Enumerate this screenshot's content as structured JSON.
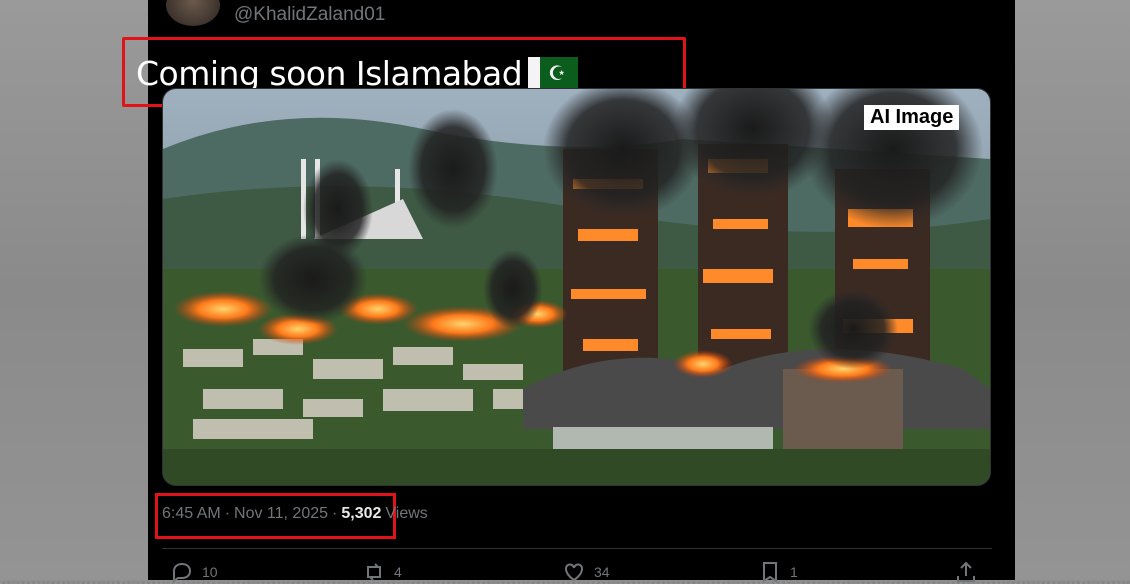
{
  "post": {
    "handle": "@KhalidZaland01",
    "text": "Coming soon Islamabad",
    "flag_icon": "pakistan-flag-icon",
    "image_badge": "AI Image",
    "time": "6:45 AM",
    "separator": "·",
    "date": "Nov 11, 2025",
    "views_count": "5,302",
    "views_label": "Views"
  },
  "actions": [
    {
      "icon": "reply-icon",
      "count": "10"
    },
    {
      "icon": "retweet-icon",
      "count": "4"
    },
    {
      "icon": "like-icon",
      "count": "34"
    },
    {
      "icon": "bookmark-icon",
      "count": "1"
    },
    {
      "icon": "share-icon",
      "count": ""
    }
  ],
  "colors": {
    "highlight_box": "#e0131b",
    "background": "#000000",
    "muted_text": "#71767b"
  }
}
